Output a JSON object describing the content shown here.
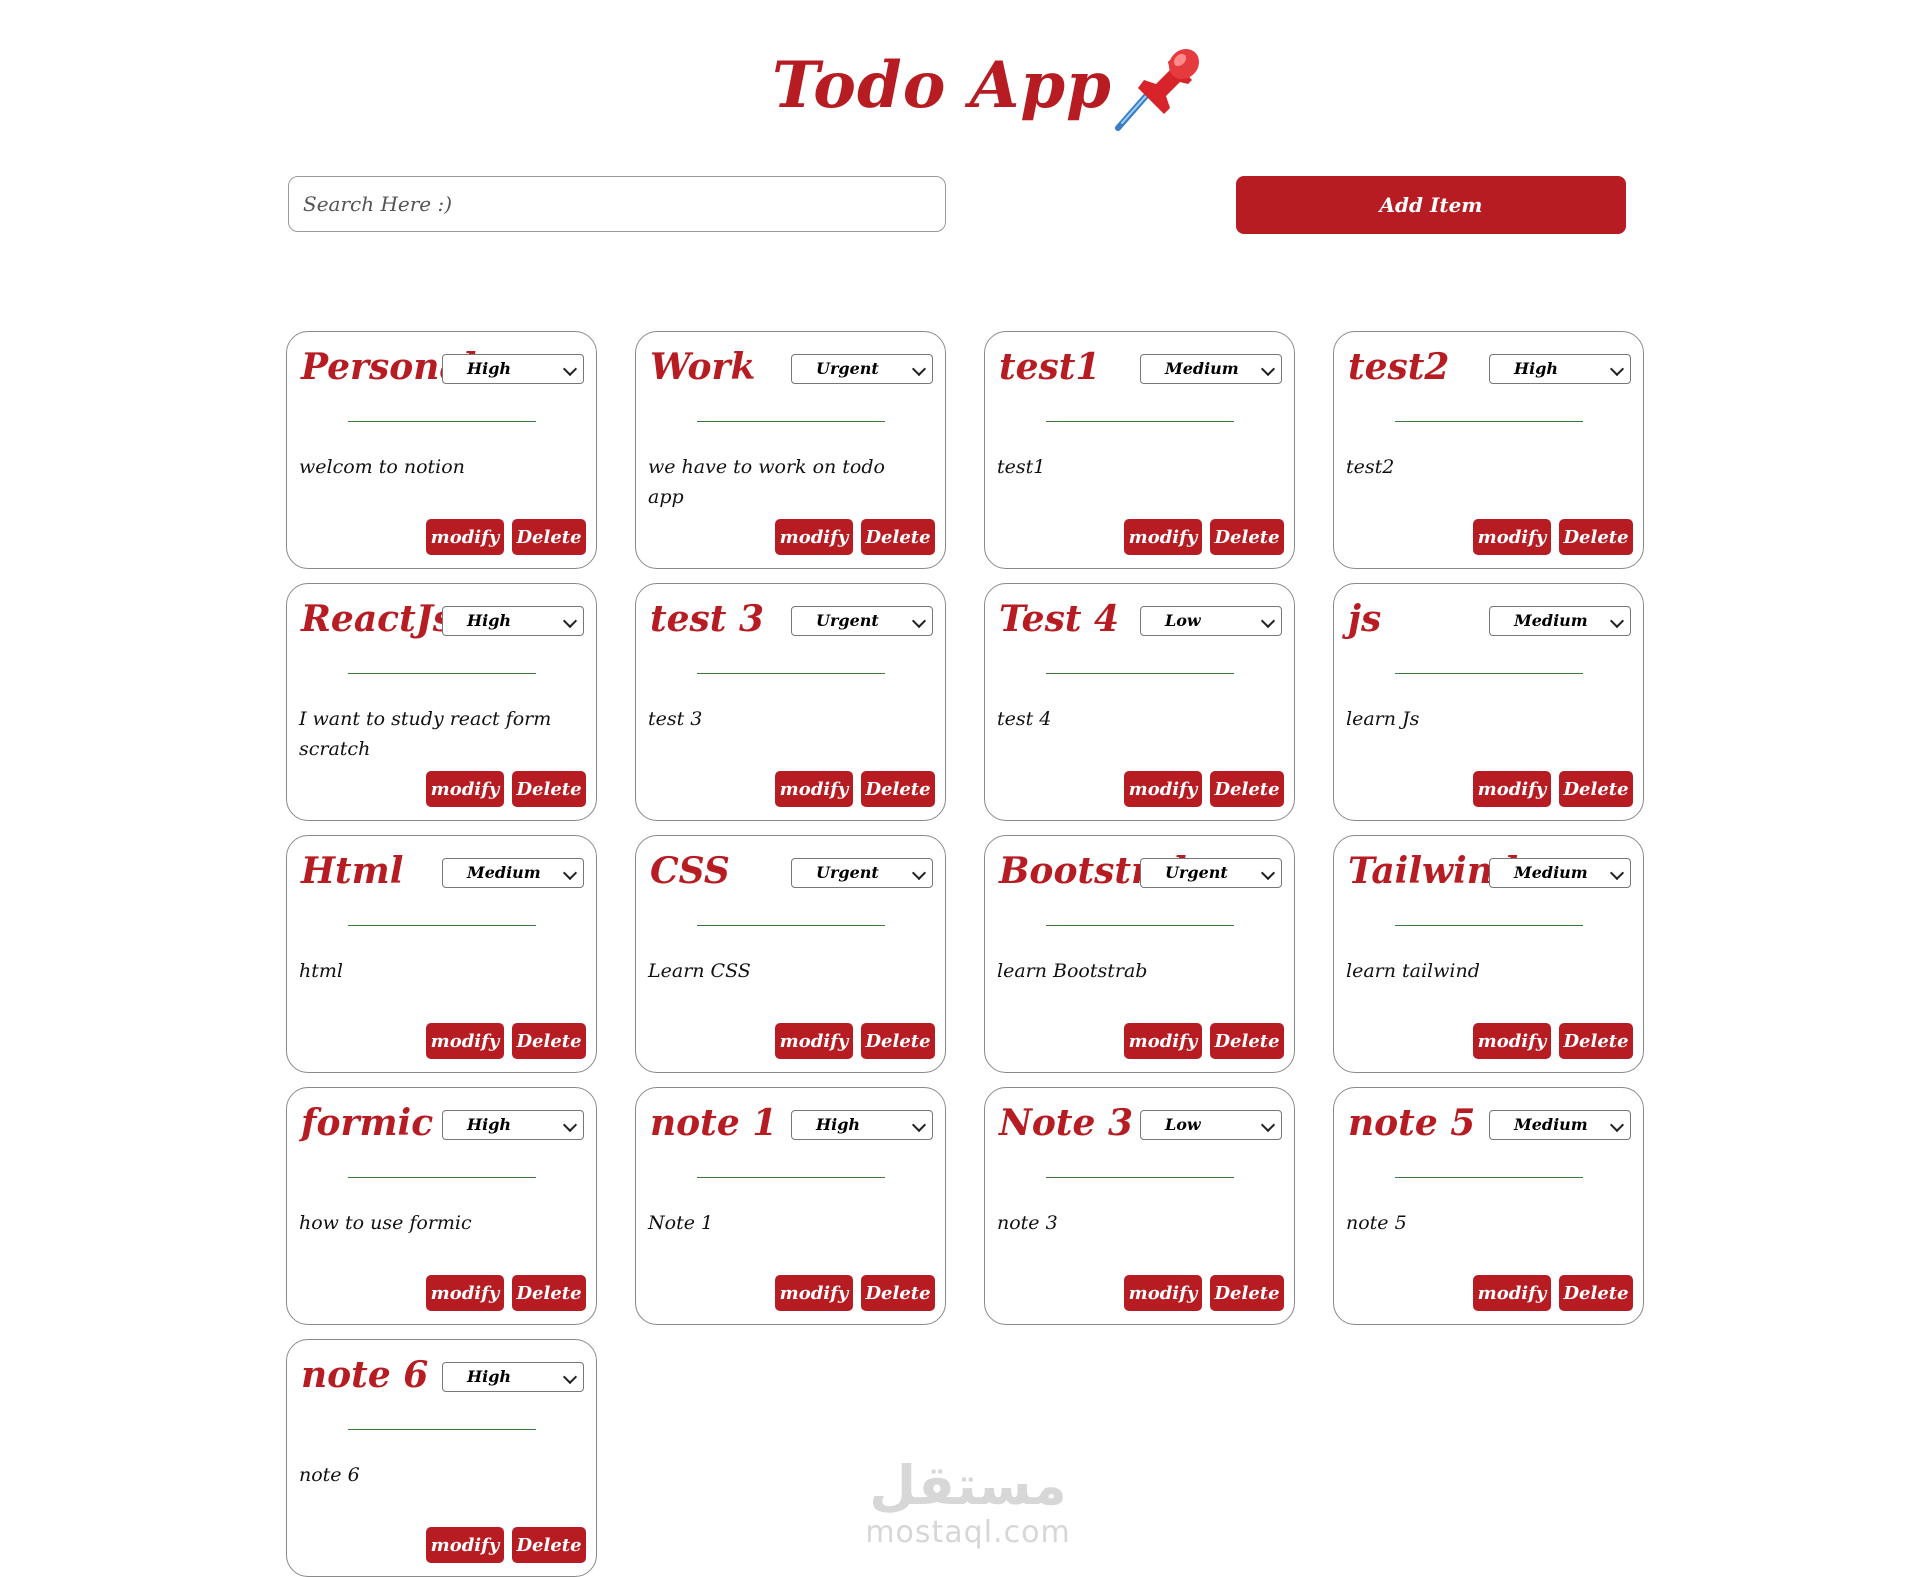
{
  "app": {
    "title": "Todo App",
    "icon": "pushpin-icon"
  },
  "toolbar": {
    "search_placeholder": "Search Here :)",
    "search_value": "",
    "add_label": "Add Item"
  },
  "colors": {
    "accent": "#b71c23",
    "divider": "#3a7a3a",
    "card_border": "#8a8a8a"
  },
  "todos": [
    {
      "title": "Personal",
      "priority": "High",
      "description": "welcom to notion"
    },
    {
      "title": "Work",
      "priority": "Urgent",
      "description": "we have to work on todo app"
    },
    {
      "title": "test1",
      "priority": "Medium",
      "description": "test1"
    },
    {
      "title": "test2",
      "priority": "High",
      "description": "test2"
    },
    {
      "title": "ReactJs",
      "priority": "High",
      "description": "I want to study react form scratch"
    },
    {
      "title": "test 3",
      "priority": "Urgent",
      "description": "test 3"
    },
    {
      "title": "Test 4",
      "priority": "Low",
      "description": "test 4"
    },
    {
      "title": "js",
      "priority": "Medium",
      "description": "learn Js"
    },
    {
      "title": "Html",
      "priority": "Medium",
      "description": "html"
    },
    {
      "title": "CSS",
      "priority": "Urgent",
      "description": "Learn CSS"
    },
    {
      "title": "Bootstrab",
      "priority": "Urgent",
      "description": "learn Bootstrab"
    },
    {
      "title": "Tailwind",
      "priority": "Medium",
      "description": "learn tailwind"
    },
    {
      "title": "formic",
      "priority": "High",
      "description": "how to use formic"
    },
    {
      "title": "note 1",
      "priority": "High",
      "description": "Note 1"
    },
    {
      "title": "Note 3",
      "priority": "Low",
      "description": "note 3"
    },
    {
      "title": "note 5",
      "priority": "Medium",
      "description": "note 5"
    },
    {
      "title": "note 6",
      "priority": "High",
      "description": "note 6"
    }
  ],
  "card_actions": {
    "modify_label": "modify",
    "delete_label": "Delete"
  },
  "watermark": {
    "arabic": "مستقل",
    "latin": "mostaql.com"
  }
}
